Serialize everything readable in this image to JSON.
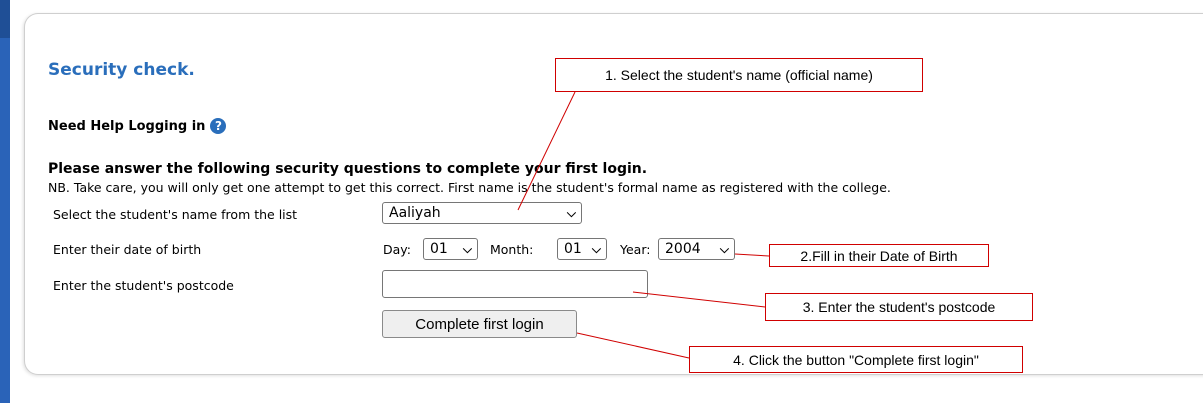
{
  "page": {
    "title": "Security check.",
    "help_text": "Need Help Logging in",
    "help_icon_glyph": "?",
    "instruction": "Please answer the following security questions to complete your first login.",
    "note": "NB. Take care, you will only get one attempt to get this correct. First name is the student's formal name as registered with the college."
  },
  "form": {
    "name_label": "Select the student's name from the list",
    "name_value": "Aaliyah",
    "dob_label": "Enter their date of birth",
    "day_label": "Day:",
    "day_value": "01",
    "month_label": "Month:",
    "month_value": "01",
    "year_label": "Year:",
    "year_value": "2004",
    "postcode_label": "Enter the student's postcode",
    "postcode_value": "",
    "submit_label": "Complete first login"
  },
  "callouts": {
    "c1": "1. Select the student's name (official name)",
    "c2": "2.Fill in their Date of Birth",
    "c3": "3. Enter the student's postcode",
    "c4": "4. Click the button \"Complete first login\""
  },
  "colors": {
    "title": "#2a6ebb",
    "sidebar": "#2a63b8",
    "callout_border": "#d00000"
  }
}
